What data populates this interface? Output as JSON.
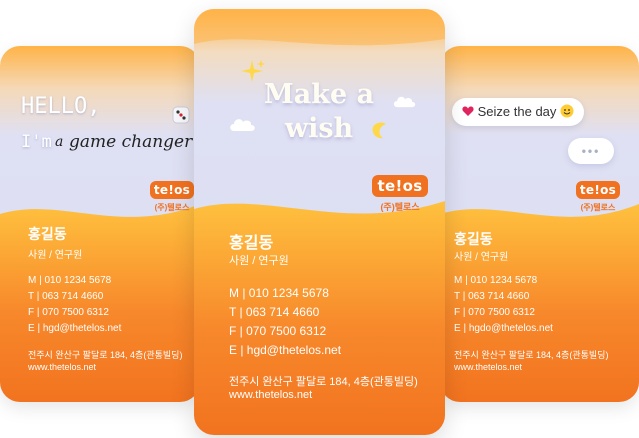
{
  "cards": {
    "left": {
      "hello": "HELLO,",
      "im": "I'm",
      "a": "a",
      "game_changer": "game changer",
      "logo": "te!os",
      "logo_sub": "(주)텔로스",
      "name": "홍길동",
      "role": "사원 / 연구원",
      "mobile": "M | 010 1234 5678",
      "tel": "T | 063 714 4660",
      "fax": "F | 070 7500 6312",
      "email": "E | hgd@thetelos.net",
      "address": "전주시 완산구 팔달로 184, 4층(관통빌딩)",
      "website": "www.thetelos.net"
    },
    "center": {
      "line1": "Make a",
      "line2": "wish",
      "logo": "te!os",
      "logo_sub": "(주)텔로스",
      "name": "홍길동",
      "role": "사원 / 연구원",
      "mobile": "M | 010 1234 5678",
      "tel": "T | 063 714 4660",
      "fax": "F | 070 7500 6312",
      "email": "E | hgd@thetelos.net",
      "address": "전주시 완산구 팔달로 184, 4층(관통빌딩)",
      "website": "www.thetelos.net"
    },
    "right": {
      "bubble_text": "Seize the day",
      "dots": "•••",
      "logo": "te!os",
      "logo_sub": "(주)텔로스",
      "name": "홍길동",
      "role": "사원 / 연구원",
      "mobile": "M | 010 1234 5678",
      "tel": "T | 063 714 4660",
      "fax": "F | 070 7500 6312",
      "email": "E | hgdo@thetelos.net",
      "address": "전주시 완산구 팔달로 184, 4층(관통빌딩)",
      "website": "www.thetelos.net"
    }
  },
  "icons": [
    "dice-icon",
    "sparkle-icon",
    "cloud-icon",
    "moon-icon",
    "heart-icon",
    "smiley-icon"
  ],
  "colors": {
    "accent": "#f0711f",
    "orange_light": "#ffb03b",
    "top_lavender": "#d9dcf5"
  }
}
